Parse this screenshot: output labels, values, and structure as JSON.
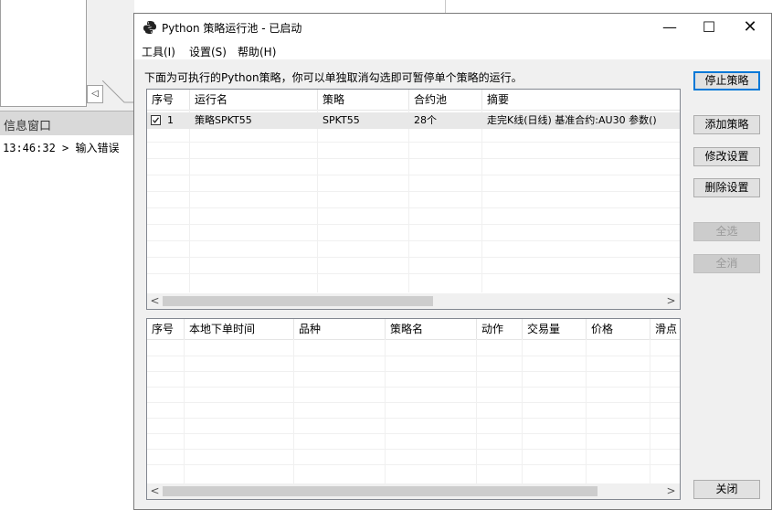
{
  "background": {
    "info_title": "信息窗口",
    "log_line": "13:46:32 > 输入错误",
    "arrow_glyph": "◁"
  },
  "window": {
    "title": "Python 策略运行池 - 已启动",
    "controls": {
      "minimize": "—",
      "maximize": "☐",
      "close": "✕"
    }
  },
  "menu": [
    "工具(I)",
    "设置(S)",
    "帮助(H)"
  ],
  "description": "下面为可执行的Python策略，你可以单独取消勾选即可暂停单个策略的运行。",
  "strategy_table": {
    "columns": [
      "序号",
      "运行名",
      "策略",
      "合约池",
      "摘要"
    ],
    "rows": [
      {
        "checked": true,
        "index": "1",
        "name": "策略SPKT55",
        "strategy": "SPKT55",
        "pool": "28个",
        "summary": "走完K线(日线) 基准合约:AU30 参数()"
      }
    ]
  },
  "order_table": {
    "columns": [
      "序号",
      "本地下单时间",
      "品种",
      "策略名",
      "动作",
      "交易量",
      "价格",
      "滑点"
    ],
    "rows": []
  },
  "scroll": {
    "left": "<",
    "right": ">"
  },
  "buttons": {
    "stop": "停止策略",
    "add": "添加策略",
    "modify": "修改设置",
    "delete": "删除设置",
    "select_all": "全选",
    "deselect_all": "全消",
    "close": "关闭"
  }
}
